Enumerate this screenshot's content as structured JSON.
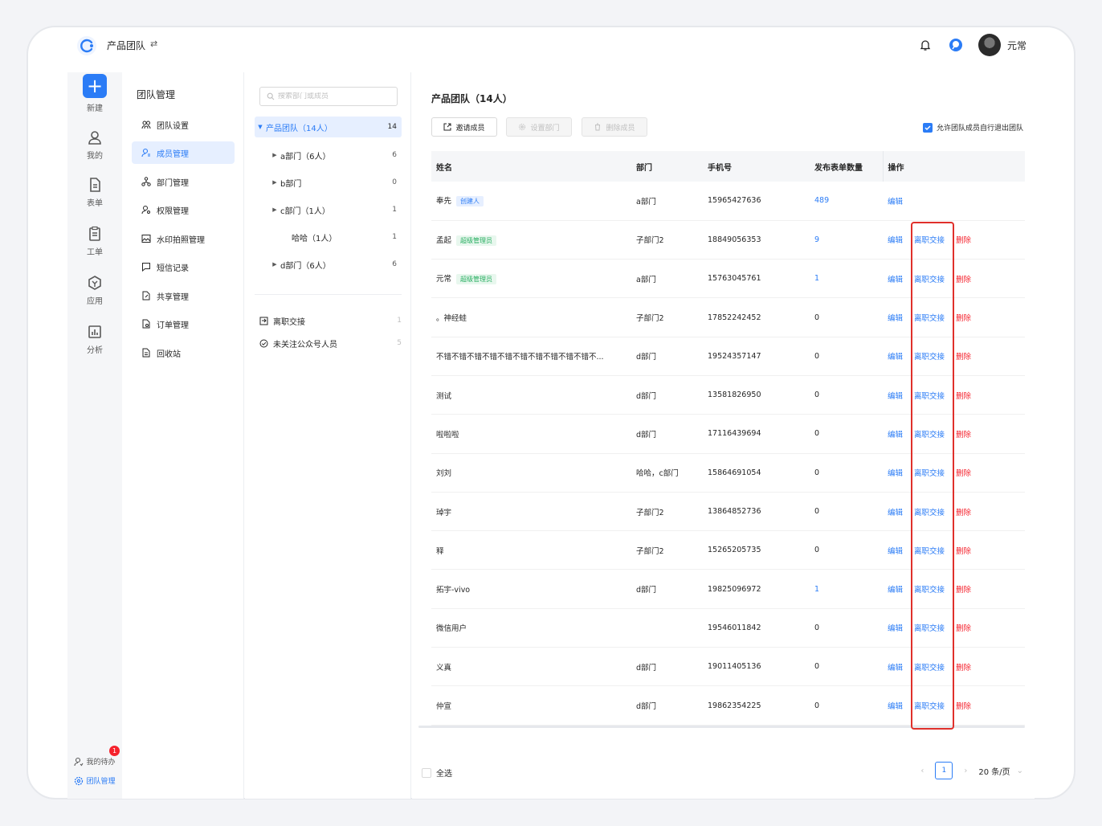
{
  "topbar": {
    "team": "产品团队",
    "user": "元常"
  },
  "rail": {
    "items": [
      "新建",
      "我的",
      "表单",
      "工单",
      "应用",
      "分析"
    ],
    "todo": "我的待办",
    "todo_badge": "1",
    "team_mgmt": "团队管理"
  },
  "menu": {
    "title": "团队管理",
    "items": [
      "团队设置",
      "成员管理",
      "部门管理",
      "权限管理",
      "水印拍照管理",
      "短信记录",
      "共享管理",
      "订单管理",
      "回收站"
    ]
  },
  "tree": {
    "search_placeholder": "搜索部门或成员",
    "rows": [
      {
        "label": "产品团队（14人）",
        "count": "14"
      },
      {
        "label": "a部门（6人）",
        "count": "6"
      },
      {
        "label": "b部门",
        "count": "0"
      },
      {
        "label": "c部门（1人）",
        "count": "1"
      },
      {
        "label": "哈哈（1人）",
        "count": "1"
      },
      {
        "label": "d部门（6人）",
        "count": "6"
      }
    ],
    "extra": [
      {
        "label": "离职交接",
        "count": "1"
      },
      {
        "label": "未关注公众号人员",
        "count": "5"
      }
    ]
  },
  "main": {
    "title": "产品团队（14人）",
    "buttons": {
      "invite": "邀请成员",
      "set_dept": "设置部门",
      "delete": "删除成员"
    },
    "allow_exit": "允许团队成员自行退出团队",
    "columns": [
      "姓名",
      "部门",
      "手机号",
      "发布表单数量",
      "操作"
    ],
    "actions": {
      "edit": "编辑",
      "handover": "离职交接",
      "delete": "删除"
    },
    "rows": [
      {
        "name": "奉先",
        "tag": "创建人",
        "dept": "a部门",
        "phone": "15965427636",
        "forms": "489"
      },
      {
        "name": "孟起",
        "tag": "超级管理员",
        "dept": "子部门2",
        "phone": "18849056353",
        "forms": "9"
      },
      {
        "name": "元常",
        "tag": "超级管理员",
        "dept": "a部门",
        "phone": "15763045761",
        "forms": "1"
      },
      {
        "name": "。神经蛙",
        "tag": "",
        "dept": "子部门2",
        "phone": "17852242452",
        "forms": "0"
      },
      {
        "name": "不错不错不错不错不错不错不错不错不错不错不...",
        "tag": "",
        "dept": "d部门",
        "phone": "19524357147",
        "forms": "0"
      },
      {
        "name": "测试",
        "tag": "",
        "dept": "d部门",
        "phone": "13581826950",
        "forms": "0"
      },
      {
        "name": "啦啦啦",
        "tag": "",
        "dept": "d部门",
        "phone": "17116439694",
        "forms": "0"
      },
      {
        "name": "刘刘",
        "tag": "",
        "dept": "哈哈，c部门",
        "phone": "15864691054",
        "forms": "0"
      },
      {
        "name": "琸宇",
        "tag": "",
        "dept": "子部门2",
        "phone": "13864852736",
        "forms": "0"
      },
      {
        "name": "释",
        "tag": "",
        "dept": "子部门2",
        "phone": "15265205735",
        "forms": "0"
      },
      {
        "name": "拓宇-vivo",
        "tag": "",
        "dept": "d部门",
        "phone": "19825096972",
        "forms": "1"
      },
      {
        "name": "微信用户",
        "tag": "",
        "dept": "",
        "phone": "19546011842",
        "forms": "0"
      },
      {
        "name": "义真",
        "tag": "",
        "dept": "d部门",
        "phone": "19011405136",
        "forms": "0"
      },
      {
        "name": "仲宣",
        "tag": "",
        "dept": "d部门",
        "phone": "19862354225",
        "forms": "0"
      }
    ],
    "select_all": "全选",
    "page": "1",
    "page_size": "20 条/页"
  }
}
